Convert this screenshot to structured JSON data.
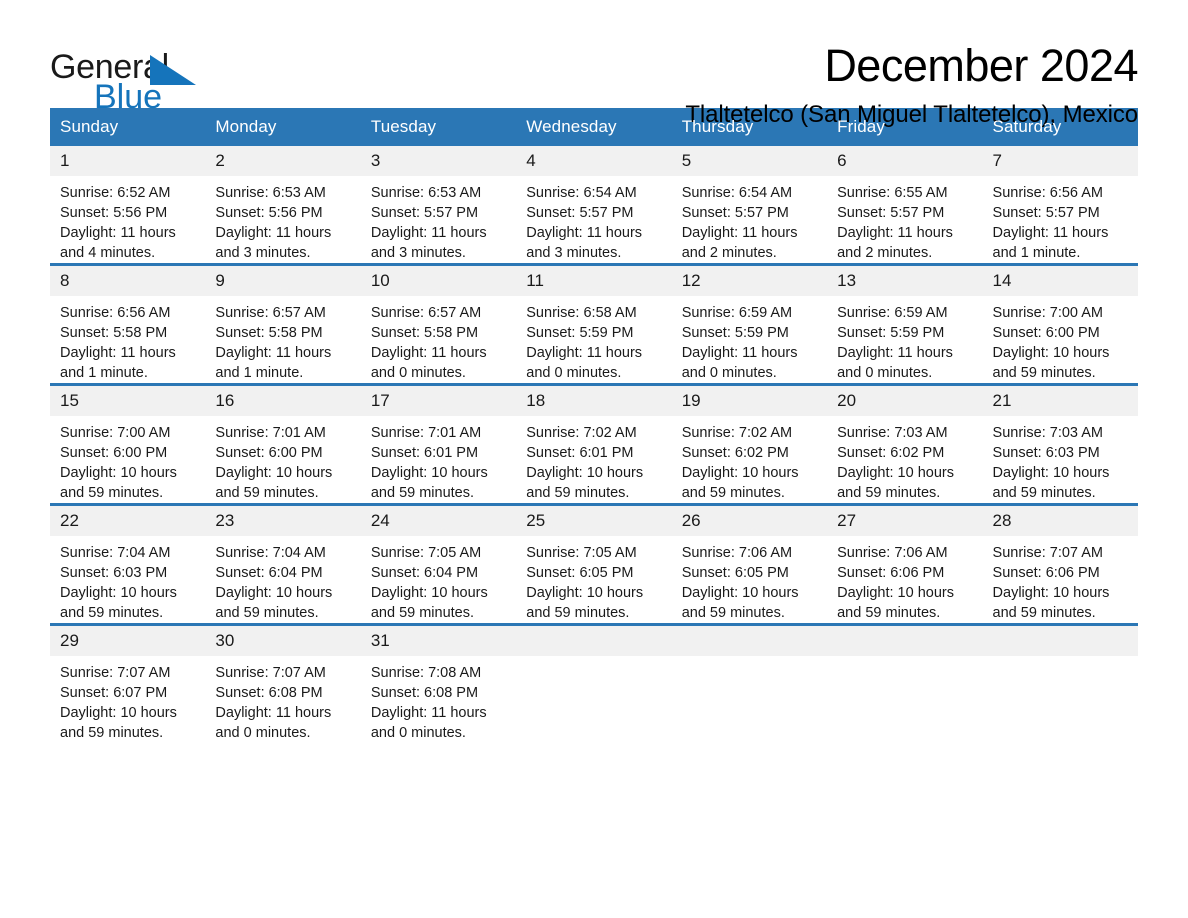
{
  "brand": {
    "name_part1": "General",
    "name_part2": "Blue",
    "logo_icon": "triangle-logo-icon",
    "accent_color": "#1574bb"
  },
  "header": {
    "month_title": "December 2024",
    "location_title": "Tlaltetelco (San Miguel Tlaltetelco), Mexico"
  },
  "theme": {
    "header_blue": "#2b77b5",
    "daynum_band": "#f1f1f1",
    "text": "#1a1a1a"
  },
  "weekday_headers": [
    "Sunday",
    "Monday",
    "Tuesday",
    "Wednesday",
    "Thursday",
    "Friday",
    "Saturday"
  ],
  "weeks": [
    [
      {
        "day": "1",
        "sunrise": "Sunrise: 6:52 AM",
        "sunset": "Sunset: 5:56 PM",
        "daylight_line1": "Daylight: 11 hours",
        "daylight_line2": "and 4 minutes."
      },
      {
        "day": "2",
        "sunrise": "Sunrise: 6:53 AM",
        "sunset": "Sunset: 5:56 PM",
        "daylight_line1": "Daylight: 11 hours",
        "daylight_line2": "and 3 minutes."
      },
      {
        "day": "3",
        "sunrise": "Sunrise: 6:53 AM",
        "sunset": "Sunset: 5:57 PM",
        "daylight_line1": "Daylight: 11 hours",
        "daylight_line2": "and 3 minutes."
      },
      {
        "day": "4",
        "sunrise": "Sunrise: 6:54 AM",
        "sunset": "Sunset: 5:57 PM",
        "daylight_line1": "Daylight: 11 hours",
        "daylight_line2": "and 3 minutes."
      },
      {
        "day": "5",
        "sunrise": "Sunrise: 6:54 AM",
        "sunset": "Sunset: 5:57 PM",
        "daylight_line1": "Daylight: 11 hours",
        "daylight_line2": "and 2 minutes."
      },
      {
        "day": "6",
        "sunrise": "Sunrise: 6:55 AM",
        "sunset": "Sunset: 5:57 PM",
        "daylight_line1": "Daylight: 11 hours",
        "daylight_line2": "and 2 minutes."
      },
      {
        "day": "7",
        "sunrise": "Sunrise: 6:56 AM",
        "sunset": "Sunset: 5:57 PM",
        "daylight_line1": "Daylight: 11 hours",
        "daylight_line2": "and 1 minute."
      }
    ],
    [
      {
        "day": "8",
        "sunrise": "Sunrise: 6:56 AM",
        "sunset": "Sunset: 5:58 PM",
        "daylight_line1": "Daylight: 11 hours",
        "daylight_line2": "and 1 minute."
      },
      {
        "day": "9",
        "sunrise": "Sunrise: 6:57 AM",
        "sunset": "Sunset: 5:58 PM",
        "daylight_line1": "Daylight: 11 hours",
        "daylight_line2": "and 1 minute."
      },
      {
        "day": "10",
        "sunrise": "Sunrise: 6:57 AM",
        "sunset": "Sunset: 5:58 PM",
        "daylight_line1": "Daylight: 11 hours",
        "daylight_line2": "and 0 minutes."
      },
      {
        "day": "11",
        "sunrise": "Sunrise: 6:58 AM",
        "sunset": "Sunset: 5:59 PM",
        "daylight_line1": "Daylight: 11 hours",
        "daylight_line2": "and 0 minutes."
      },
      {
        "day": "12",
        "sunrise": "Sunrise: 6:59 AM",
        "sunset": "Sunset: 5:59 PM",
        "daylight_line1": "Daylight: 11 hours",
        "daylight_line2": "and 0 minutes."
      },
      {
        "day": "13",
        "sunrise": "Sunrise: 6:59 AM",
        "sunset": "Sunset: 5:59 PM",
        "daylight_line1": "Daylight: 11 hours",
        "daylight_line2": "and 0 minutes."
      },
      {
        "day": "14",
        "sunrise": "Sunrise: 7:00 AM",
        "sunset": "Sunset: 6:00 PM",
        "daylight_line1": "Daylight: 10 hours",
        "daylight_line2": "and 59 minutes."
      }
    ],
    [
      {
        "day": "15",
        "sunrise": "Sunrise: 7:00 AM",
        "sunset": "Sunset: 6:00 PM",
        "daylight_line1": "Daylight: 10 hours",
        "daylight_line2": "and 59 minutes."
      },
      {
        "day": "16",
        "sunrise": "Sunrise: 7:01 AM",
        "sunset": "Sunset: 6:00 PM",
        "daylight_line1": "Daylight: 10 hours",
        "daylight_line2": "and 59 minutes."
      },
      {
        "day": "17",
        "sunrise": "Sunrise: 7:01 AM",
        "sunset": "Sunset: 6:01 PM",
        "daylight_line1": "Daylight: 10 hours",
        "daylight_line2": "and 59 minutes."
      },
      {
        "day": "18",
        "sunrise": "Sunrise: 7:02 AM",
        "sunset": "Sunset: 6:01 PM",
        "daylight_line1": "Daylight: 10 hours",
        "daylight_line2": "and 59 minutes."
      },
      {
        "day": "19",
        "sunrise": "Sunrise: 7:02 AM",
        "sunset": "Sunset: 6:02 PM",
        "daylight_line1": "Daylight: 10 hours",
        "daylight_line2": "and 59 minutes."
      },
      {
        "day": "20",
        "sunrise": "Sunrise: 7:03 AM",
        "sunset": "Sunset: 6:02 PM",
        "daylight_line1": "Daylight: 10 hours",
        "daylight_line2": "and 59 minutes."
      },
      {
        "day": "21",
        "sunrise": "Sunrise: 7:03 AM",
        "sunset": "Sunset: 6:03 PM",
        "daylight_line1": "Daylight: 10 hours",
        "daylight_line2": "and 59 minutes."
      }
    ],
    [
      {
        "day": "22",
        "sunrise": "Sunrise: 7:04 AM",
        "sunset": "Sunset: 6:03 PM",
        "daylight_line1": "Daylight: 10 hours",
        "daylight_line2": "and 59 minutes."
      },
      {
        "day": "23",
        "sunrise": "Sunrise: 7:04 AM",
        "sunset": "Sunset: 6:04 PM",
        "daylight_line1": "Daylight: 10 hours",
        "daylight_line2": "and 59 minutes."
      },
      {
        "day": "24",
        "sunrise": "Sunrise: 7:05 AM",
        "sunset": "Sunset: 6:04 PM",
        "daylight_line1": "Daylight: 10 hours",
        "daylight_line2": "and 59 minutes."
      },
      {
        "day": "25",
        "sunrise": "Sunrise: 7:05 AM",
        "sunset": "Sunset: 6:05 PM",
        "daylight_line1": "Daylight: 10 hours",
        "daylight_line2": "and 59 minutes."
      },
      {
        "day": "26",
        "sunrise": "Sunrise: 7:06 AM",
        "sunset": "Sunset: 6:05 PM",
        "daylight_line1": "Daylight: 10 hours",
        "daylight_line2": "and 59 minutes."
      },
      {
        "day": "27",
        "sunrise": "Sunrise: 7:06 AM",
        "sunset": "Sunset: 6:06 PM",
        "daylight_line1": "Daylight: 10 hours",
        "daylight_line2": "and 59 minutes."
      },
      {
        "day": "28",
        "sunrise": "Sunrise: 7:07 AM",
        "sunset": "Sunset: 6:06 PM",
        "daylight_line1": "Daylight: 10 hours",
        "daylight_line2": "and 59 minutes."
      }
    ],
    [
      {
        "day": "29",
        "sunrise": "Sunrise: 7:07 AM",
        "sunset": "Sunset: 6:07 PM",
        "daylight_line1": "Daylight: 10 hours",
        "daylight_line2": "and 59 minutes."
      },
      {
        "day": "30",
        "sunrise": "Sunrise: 7:07 AM",
        "sunset": "Sunset: 6:08 PM",
        "daylight_line1": "Daylight: 11 hours",
        "daylight_line2": "and 0 minutes."
      },
      {
        "day": "31",
        "sunrise": "Sunrise: 7:08 AM",
        "sunset": "Sunset: 6:08 PM",
        "daylight_line1": "Daylight: 11 hours",
        "daylight_line2": "and 0 minutes."
      },
      {
        "day": "",
        "sunrise": "",
        "sunset": "",
        "daylight_line1": "",
        "daylight_line2": ""
      },
      {
        "day": "",
        "sunrise": "",
        "sunset": "",
        "daylight_line1": "",
        "daylight_line2": ""
      },
      {
        "day": "",
        "sunrise": "",
        "sunset": "",
        "daylight_line1": "",
        "daylight_line2": ""
      },
      {
        "day": "",
        "sunrise": "",
        "sunset": "",
        "daylight_line1": "",
        "daylight_line2": ""
      }
    ]
  ]
}
